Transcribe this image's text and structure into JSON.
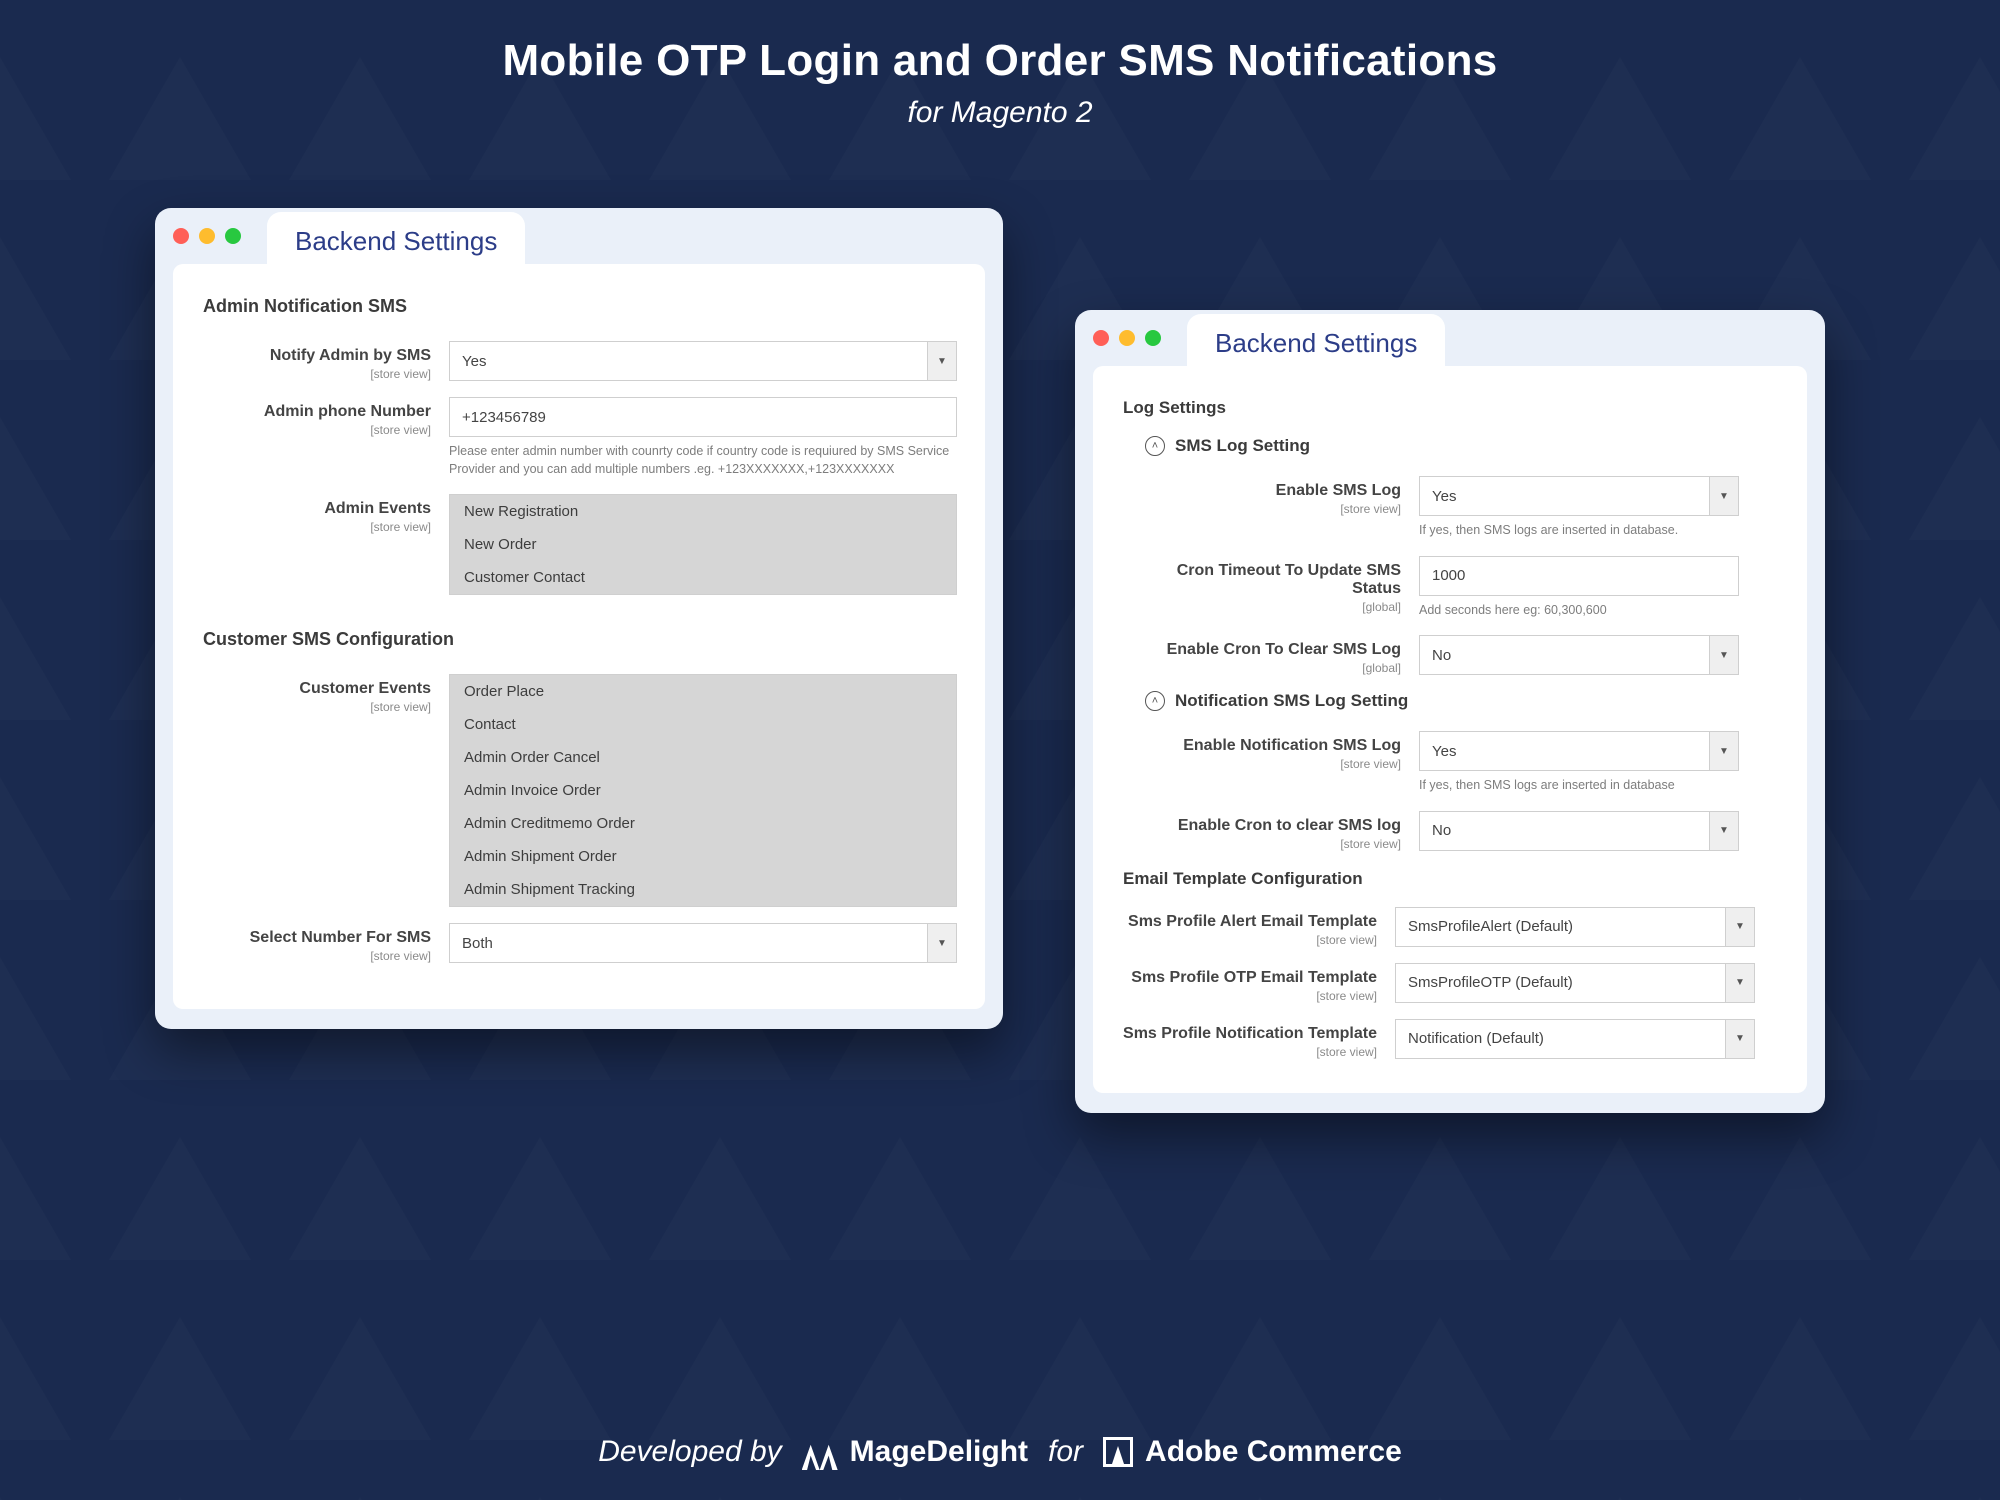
{
  "header": {
    "title": "Mobile OTP Login and Order SMS Notifications",
    "subtitle": "for Magento 2"
  },
  "windowLeft": {
    "tab": "Backend Settings",
    "sectionA": "Admin Notification SMS",
    "fields": {
      "notifyAdmin": {
        "label": "Notify Admin by SMS",
        "scope": "[store view]",
        "value": "Yes"
      },
      "adminPhone": {
        "label": "Admin phone Number",
        "scope": "[store view]",
        "value": "+123456789",
        "help": "Please enter admin number with counrty code if country code is requiured by SMS Service Provider and you can add multiple numbers .eg. +123XXXXXXX,+123XXXXXXX"
      },
      "adminEvents": {
        "label": "Admin Events",
        "scope": "[store view]",
        "options": [
          "New Registration",
          "New Order",
          "Customer Contact"
        ]
      }
    },
    "sectionB": "Customer SMS Configuration",
    "fieldsB": {
      "customerEvents": {
        "label": "Customer Events",
        "scope": "[store view]",
        "options": [
          "Order Place",
          "Contact",
          "Admin Order Cancel",
          "Admin Invoice Order",
          "Admin Creditmemo Order",
          "Admin Shipment Order",
          "Admin Shipment Tracking"
        ]
      },
      "selectNumber": {
        "label": "Select Number For SMS",
        "scope": "[store view]",
        "value": "Both"
      }
    }
  },
  "windowRight": {
    "tab": "Backend Settings",
    "sectionA": "Log Settings",
    "groupA": "SMS Log Setting",
    "fieldsA": {
      "enableSmsLog": {
        "label": "Enable SMS Log",
        "scope": "[store view]",
        "value": "Yes",
        "help": "If yes, then SMS logs are inserted in database."
      },
      "cronTimeout": {
        "label": "Cron Timeout To Update SMS Status",
        "scope": "[global]",
        "value": "1000",
        "help": "Add seconds here eg: 60,300,600"
      },
      "enableCronClear": {
        "label": "Enable Cron To Clear SMS Log",
        "scope": "[global]",
        "value": "No"
      }
    },
    "groupB": "Notification SMS Log Setting",
    "fieldsB": {
      "enableNotifLog": {
        "label": "Enable Notification SMS Log",
        "scope": "[store view]",
        "value": "Yes",
        "help": "If yes, then SMS logs are inserted in database"
      },
      "enableCronNotif": {
        "label": "Enable Cron to clear SMS log",
        "scope": "[store view]",
        "value": "No"
      }
    },
    "sectionB": "Email Template Configuration",
    "fieldsC": {
      "tpl1": {
        "label": "Sms Profile Alert Email Template",
        "scope": "[store view]",
        "value": "SmsProfileAlert (Default)"
      },
      "tpl2": {
        "label": "Sms Profile OTP Email Template",
        "scope": "[store view]",
        "value": "SmsProfileOTP (Default)"
      },
      "tpl3": {
        "label": "Sms Profile Notification Template",
        "scope": "[store view]",
        "value": "Notification (Default)"
      }
    }
  },
  "footer": {
    "devby": "Developed by",
    "brand1": "MageDelight",
    "for": "for",
    "brand2": "Adobe Commerce"
  }
}
